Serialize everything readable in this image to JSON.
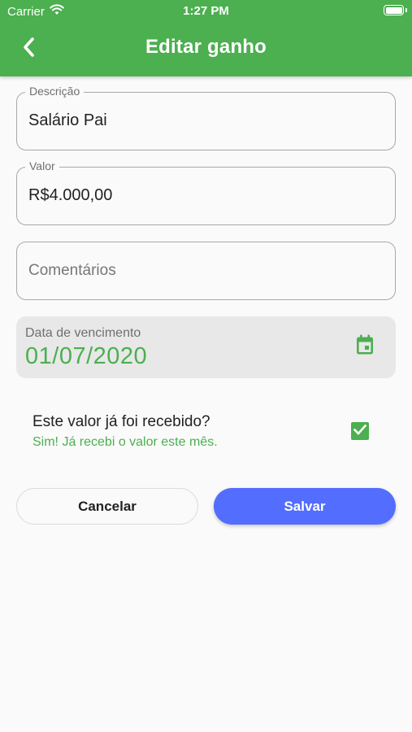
{
  "status_bar": {
    "carrier": "Carrier",
    "time": "1:27 PM",
    "wifi_icon": "wifi-icon",
    "battery_icon": "battery-icon",
    "battery_level": 1.0
  },
  "header": {
    "title": "Editar ganho",
    "back_icon": "chevron-left-icon",
    "color": "#4caf50"
  },
  "form": {
    "description": {
      "label": "Descrição",
      "value": "Salário Pai"
    },
    "amount": {
      "label": "Valor",
      "value": "R$4.000,00"
    },
    "comments": {
      "placeholder": "Comentários",
      "value": ""
    },
    "due_date": {
      "label": "Data de vencimento",
      "value": "01/07/2020",
      "icon": "calendar-icon"
    }
  },
  "received": {
    "question": "Este valor já foi recebido?",
    "answer": "Sim! Já recebi o valor este mês.",
    "checked": true
  },
  "actions": {
    "cancel_label": "Cancelar",
    "save_label": "Salvar",
    "save_color": "#536dfe"
  }
}
